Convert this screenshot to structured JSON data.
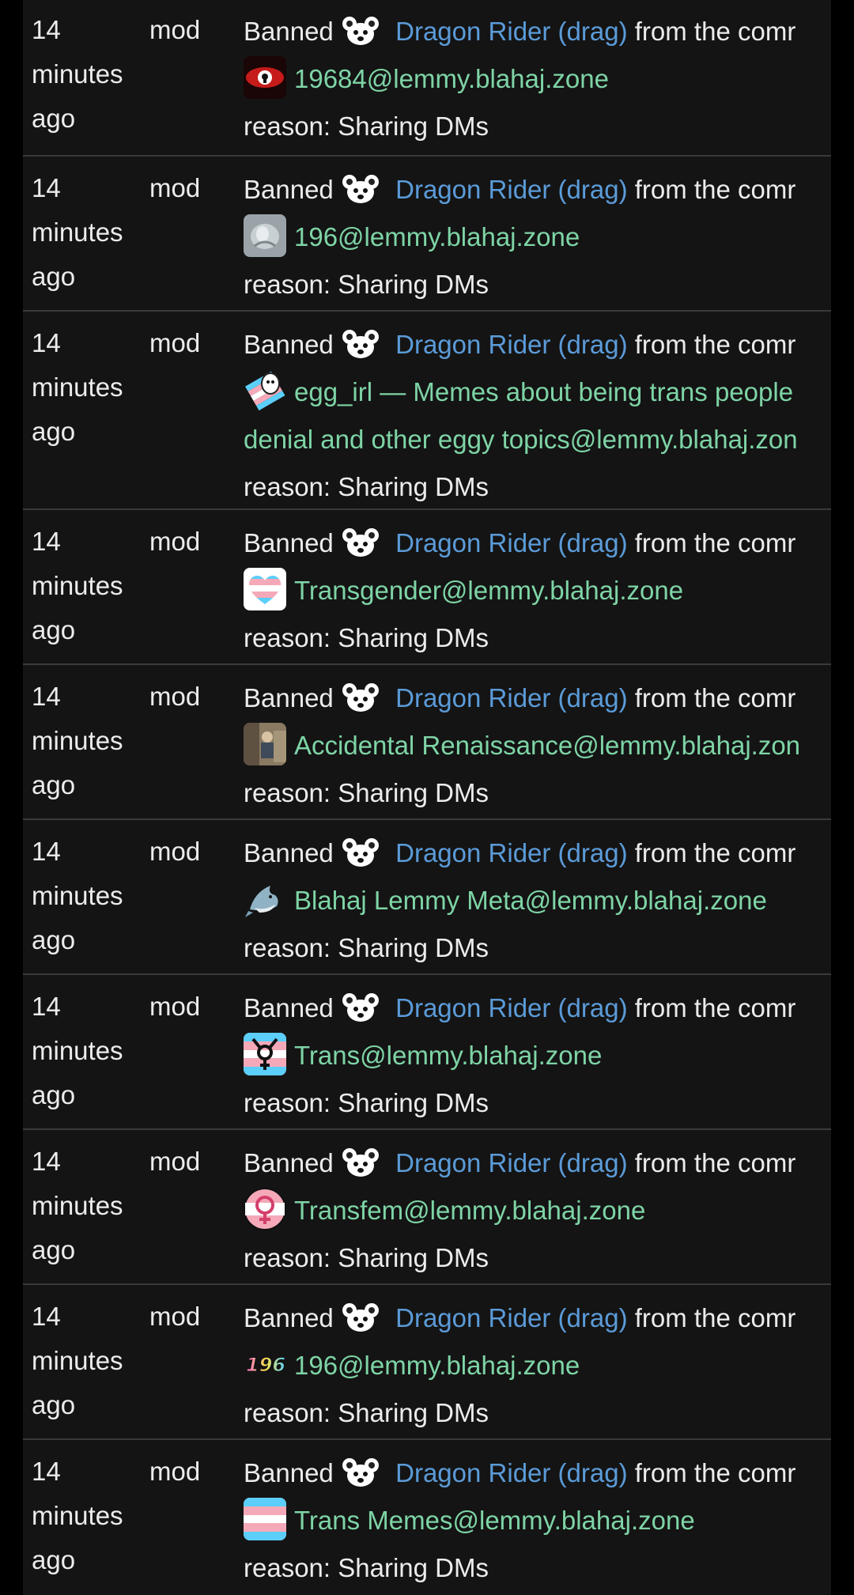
{
  "modlog": {
    "entries": [
      {
        "time": [
          "14",
          "minutes",
          "ago"
        ],
        "actor": "mod",
        "action_prefix": "Banned",
        "user": "Dragon Rider (drag)",
        "action_suffix": "from the comr",
        "community": "19684@lemmy.blahaj.zone",
        "community_icon": "red-eye-icon",
        "reason": "reason: Sharing DMs"
      },
      {
        "time": [
          "14",
          "minutes",
          "ago"
        ],
        "actor": "mod",
        "action_prefix": "Banned",
        "user": "Dragon Rider (drag)",
        "action_suffix": "from the comr",
        "community": "196@lemmy.blahaj.zone",
        "community_icon": "grey-blob-icon",
        "reason": "reason: Sharing DMs"
      },
      {
        "time": [
          "14",
          "minutes",
          "ago"
        ],
        "actor": "mod",
        "action_prefix": "Banned",
        "user": "Dragon Rider (drag)",
        "action_suffix": "from the comr",
        "community": "egg_irl — Memes about being trans people",
        "community_cont": "denial and other eggy topics@lemmy.blahaj.zon",
        "community_icon": "egg-icon",
        "reason": "reason: Sharing DMs"
      },
      {
        "time": [
          "14",
          "minutes",
          "ago"
        ],
        "actor": "mod",
        "action_prefix": "Banned",
        "user": "Dragon Rider (drag)",
        "action_suffix": "from the comr",
        "community": "Transgender@lemmy.blahaj.zone",
        "community_icon": "trans-heart-icon",
        "reason": "reason: Sharing DMs"
      },
      {
        "time": [
          "14",
          "minutes",
          "ago"
        ],
        "actor": "mod",
        "action_prefix": "Banned",
        "user": "Dragon Rider (drag)",
        "action_suffix": "from the comr",
        "community": "Accidental Renaissance@lemmy.blahaj.zon",
        "community_icon": "photo-icon",
        "reason": "reason: Sharing DMs"
      },
      {
        "time": [
          "14",
          "minutes",
          "ago"
        ],
        "actor": "mod",
        "action_prefix": "Banned",
        "user": "Dragon Rider (drag)",
        "action_suffix": "from the comr",
        "community": "Blahaj Lemmy Meta@lemmy.blahaj.zone",
        "community_icon": "shark-icon",
        "reason": "reason: Sharing DMs"
      },
      {
        "time": [
          "14",
          "minutes",
          "ago"
        ],
        "actor": "mod",
        "action_prefix": "Banned",
        "user": "Dragon Rider (drag)",
        "action_suffix": "from the comr",
        "community": "Trans@lemmy.blahaj.zone",
        "community_icon": "trans-symbol-icon",
        "reason": "reason: Sharing DMs"
      },
      {
        "time": [
          "14",
          "minutes",
          "ago"
        ],
        "actor": "mod",
        "action_prefix": "Banned",
        "user": "Dragon Rider (drag)",
        "action_suffix": "from the comr",
        "community": "Transfem@lemmy.blahaj.zone",
        "community_icon": "venus-symbol-icon",
        "reason": "reason: Sharing DMs"
      },
      {
        "time": [
          "14",
          "minutes",
          "ago"
        ],
        "actor": "mod",
        "action_prefix": "Banned",
        "user": "Dragon Rider (drag)",
        "action_suffix": "from the comr",
        "community": "196@lemmy.blahaj.zone",
        "community_icon": "196-logo-icon",
        "community_icon_text": "196",
        "reason": "reason: Sharing DMs"
      },
      {
        "time": [
          "14",
          "minutes",
          "ago"
        ],
        "actor": "mod",
        "action_prefix": "Banned",
        "user": "Dragon Rider (drag)",
        "action_suffix": "from the comr",
        "community": "Trans Memes@lemmy.blahaj.zone",
        "community_icon": "trans-flag-icon",
        "reason": "reason: Sharing DMs"
      }
    ]
  },
  "colors": {
    "background": "#141414",
    "page_edge": "#000000",
    "text": "#ececec",
    "user_link": "#5b9bd8",
    "community_link": "#7ed4a6",
    "divider": "#3a3a3a"
  }
}
